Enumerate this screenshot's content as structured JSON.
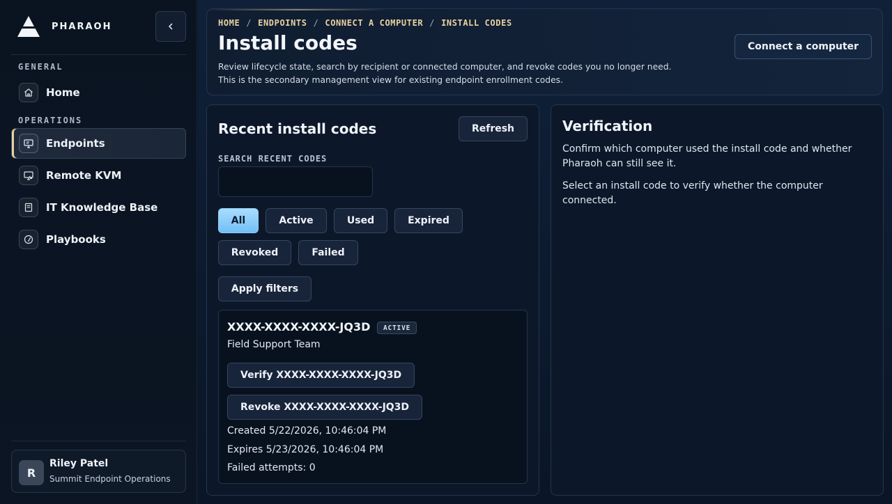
{
  "brand": {
    "name": "PHARAOH"
  },
  "sidebar": {
    "sections": [
      {
        "label": "GENERAL"
      },
      {
        "label": "OPERATIONS"
      }
    ],
    "items": [
      {
        "label": "Home",
        "icon": "home-icon"
      },
      {
        "label": "Endpoints",
        "icon": "monitor-icon",
        "active": true
      },
      {
        "label": "Remote KVM",
        "icon": "remote-screen-icon"
      },
      {
        "label": "IT Knowledge Base",
        "icon": "book-icon"
      },
      {
        "label": "Playbooks",
        "icon": "gauge-icon"
      }
    ],
    "user": {
      "initial": "R",
      "name": "Riley Patel",
      "org": "Summit Endpoint Operations"
    }
  },
  "header": {
    "breadcrumb": [
      "HOME",
      "ENDPOINTS",
      "CONNECT A COMPUTER",
      "INSTALL CODES"
    ],
    "title": "Install codes",
    "description_line1": "Review lifecycle state, search by recipient or connected computer, and revoke codes you no longer need.",
    "description_line2": "This is the secondary management view for existing endpoint enrollment codes.",
    "connect_label": "Connect a computer"
  },
  "codes_panel": {
    "title": "Recent install codes",
    "refresh_label": "Refresh",
    "search_label": "SEARCH RECENT CODES",
    "search_value": "",
    "search_placeholder": "",
    "filters": [
      "All",
      "Active",
      "Used",
      "Expired",
      "Revoked",
      "Failed"
    ],
    "selected_filter": "All",
    "apply_label": "Apply filters",
    "codes": [
      {
        "code": "XXXX-XXXX-XXXX-JQ3D",
        "status": "ACTIVE",
        "recipient": "Field Support Team",
        "verify_label": "Verify XXXX-XXXX-XXXX-JQ3D",
        "revoke_label": "Revoke XXXX-XXXX-XXXX-JQ3D",
        "created": "Created 5/22/2026, 10:46:04 PM",
        "expires": "Expires 5/23/2026, 10:46:04 PM",
        "failed_attempts": "Failed attempts: 0"
      }
    ]
  },
  "verification": {
    "title": "Verification",
    "intro": "Confirm which computer used the install code and whether Pharaoh can still see it.",
    "empty_state": "Select an install code to verify whether the computer connected."
  },
  "colors": {
    "accent_gold": "#e8d3a0",
    "selected_chip": "#8fd0ff",
    "background": "#0a1524"
  }
}
